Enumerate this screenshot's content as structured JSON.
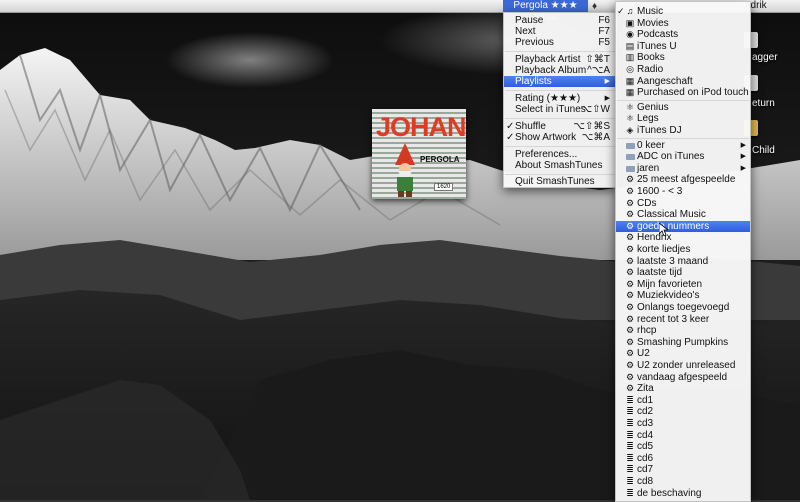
{
  "menubar": {
    "status_item": "Pergola ★★★ Johan",
    "user_name": "ndrik",
    "extras_icons": [
      "twitter-icon"
    ]
  },
  "album": {
    "title": "JOHAN",
    "subtitle": "PERGOLA",
    "tag": "1620"
  },
  "desktop_labels": {
    "item1": "agger",
    "item2": "eturn",
    "item3": "Child"
  },
  "main_menu": {
    "items": [
      {
        "label": "Pause",
        "shortcut": "F6"
      },
      {
        "label": "Next",
        "shortcut": "F7"
      },
      {
        "label": "Previous",
        "shortcut": "F5"
      },
      {
        "label": "Playback Artist",
        "shortcut": "⇧⌘T"
      },
      {
        "label": "Playback Album",
        "shortcut": "^⌥A"
      },
      {
        "label": "Playlists",
        "shortcut": "▶"
      },
      {
        "label": "Rating (★★★)",
        "shortcut": "▶"
      },
      {
        "label": "Select in iTunes",
        "shortcut": "⌥⇧W"
      },
      {
        "label": "Shuffle",
        "shortcut": "⌥⇧⌘S",
        "checked": "✓"
      },
      {
        "label": "Show Artwork",
        "shortcut": "⌥⌘A",
        "checked": "✓"
      },
      {
        "label": "Preferences...",
        "shortcut": ""
      },
      {
        "label": "About SmashTunes",
        "shortcut": ""
      },
      {
        "label": "Quit SmashTunes",
        "shortcut": ""
      }
    ],
    "highlighted": "Playlists"
  },
  "playlists_menu": {
    "check": "✓",
    "items": [
      {
        "label": "Music",
        "icon": "music-note-icon"
      },
      {
        "label": "Movies",
        "icon": "movie-icon"
      },
      {
        "label": "Podcasts",
        "icon": "podcast-icon"
      },
      {
        "label": "iTunes U",
        "icon": "itunes-u-icon"
      },
      {
        "label": "Books",
        "icon": "book-icon"
      },
      {
        "label": "Radio",
        "icon": "radio-icon"
      },
      {
        "label": "Aangeschaft",
        "icon": "purchased-icon"
      },
      {
        "label": "Purchased on iPod touch",
        "icon": "purchased-icon"
      },
      {
        "label": "Genius",
        "icon": "genius-icon"
      },
      {
        "label": "Legs",
        "icon": "genius-icon"
      },
      {
        "label": "iTunes DJ",
        "icon": "dj-icon"
      },
      {
        "label": "0 keer",
        "icon": "folder-icon",
        "arrow": "▶"
      },
      {
        "label": "ADC on iTunes",
        "icon": "folder-icon",
        "arrow": "▶"
      },
      {
        "label": "jaren",
        "icon": "folder-icon",
        "arrow": "▶"
      },
      {
        "label": "25 meest afgespeelde",
        "icon": "smart-playlist-icon"
      },
      {
        "label": "1600 - < 3",
        "icon": "smart-playlist-icon"
      },
      {
        "label": "CDs",
        "icon": "smart-playlist-icon"
      },
      {
        "label": "Classical Music",
        "icon": "smart-playlist-icon"
      },
      {
        "label": "goede nummers",
        "icon": "smart-playlist-icon"
      },
      {
        "label": "Hendrix",
        "icon": "smart-playlist-icon"
      },
      {
        "label": "korte liedjes",
        "icon": "smart-playlist-icon"
      },
      {
        "label": "laatste 3 maand",
        "icon": "smart-playlist-icon"
      },
      {
        "label": "laatste tijd",
        "icon": "smart-playlist-icon"
      },
      {
        "label": "Mijn favorieten",
        "icon": "smart-playlist-icon"
      },
      {
        "label": "Muziekvideo's",
        "icon": "smart-playlist-icon"
      },
      {
        "label": "Onlangs toegevoegd",
        "icon": "smart-playlist-icon"
      },
      {
        "label": "recent tot 3 keer",
        "icon": "smart-playlist-icon"
      },
      {
        "label": "rhcp",
        "icon": "smart-playlist-icon"
      },
      {
        "label": "Smashing Pumpkins",
        "icon": "smart-playlist-icon"
      },
      {
        "label": "U2",
        "icon": "smart-playlist-icon"
      },
      {
        "label": "U2 zonder unreleased",
        "icon": "smart-playlist-icon"
      },
      {
        "label": "vandaag afgespeeld",
        "icon": "smart-playlist-icon"
      },
      {
        "label": "Zita",
        "icon": "smart-playlist-icon"
      },
      {
        "label": "cd1",
        "icon": "playlist-icon"
      },
      {
        "label": "cd2",
        "icon": "playlist-icon"
      },
      {
        "label": "cd3",
        "icon": "playlist-icon"
      },
      {
        "label": "cd4",
        "icon": "playlist-icon"
      },
      {
        "label": "cd5",
        "icon": "playlist-icon"
      },
      {
        "label": "cd6",
        "icon": "playlist-icon"
      },
      {
        "label": "cd7",
        "icon": "playlist-icon"
      },
      {
        "label": "cd8",
        "icon": "playlist-icon"
      },
      {
        "label": "de beschaving",
        "icon": "playlist-icon"
      }
    ],
    "highlighted": "goede nummers"
  },
  "colors": {
    "highlight": "#2e5ee0",
    "menubar": "#e4e4e4",
    "album_red": "#e23a20"
  }
}
